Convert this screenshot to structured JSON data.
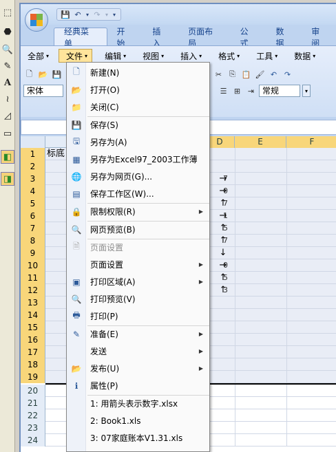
{
  "left_toolbar": {
    "tools": [
      "select-icon",
      "paint-icon",
      "zoom-icon",
      "pen-icon",
      "text-icon",
      "freehand-icon",
      "eraser-icon",
      "shape-icon",
      "green-3d-icon",
      "green-layers-icon"
    ]
  },
  "quick_access": {
    "save": "💾",
    "undo": "↶",
    "undo_dd": "▾",
    "redo": "↷",
    "redo_dd": "▾",
    "customize": "▾"
  },
  "ribbon_tabs": [
    "经典菜单",
    "开始",
    "插入",
    "页面布局",
    "公式",
    "数据",
    "审阅"
  ],
  "classic_menubar": [
    {
      "label": "全部",
      "open": false
    },
    {
      "label": "文件",
      "open": true
    },
    {
      "label": "编辑",
      "open": false
    },
    {
      "label": "视图",
      "open": false
    },
    {
      "label": "插入",
      "open": false
    },
    {
      "label": "格式",
      "open": false
    },
    {
      "label": "工具",
      "open": false
    },
    {
      "label": "数据",
      "open": false
    }
  ],
  "toolbar": {
    "font_name": "宋体",
    "number_format": "常规"
  },
  "columns": [
    "D",
    "E",
    "F"
  ],
  "rows": [
    {
      "n": "1",
      "a": "标底",
      "d": "",
      "arr": ""
    },
    {
      "n": "2",
      "a": "",
      "d": "",
      "arr": ""
    },
    {
      "n": "3",
      "a": "",
      "d": "7",
      "arr": "→"
    },
    {
      "n": "4",
      "a": "",
      "d": "0",
      "arr": "→"
    },
    {
      "n": "5",
      "a": "",
      "d": "7",
      "arr": "↑"
    },
    {
      "n": "6",
      "a": "",
      "d": "1",
      "arr": "→"
    },
    {
      "n": "7",
      "a": "",
      "d": "5",
      "arr": "↑"
    },
    {
      "n": "8",
      "a": "",
      "d": "7",
      "arr": "↑"
    },
    {
      "n": "9",
      "a": "",
      "d": "",
      "arr": "↓"
    },
    {
      "n": "10",
      "a": "",
      "d": "0",
      "arr": "→"
    },
    {
      "n": "11",
      "a": "",
      "d": "5",
      "arr": "↑"
    },
    {
      "n": "12",
      "a": "",
      "d": "3",
      "arr": "↑"
    },
    {
      "n": "13",
      "a": "",
      "d": "",
      "arr": ""
    },
    {
      "n": "14",
      "a": "",
      "d": "",
      "arr": ""
    },
    {
      "n": "15",
      "a": "",
      "d": "",
      "arr": ""
    },
    {
      "n": "16",
      "a": "",
      "d": "",
      "arr": ""
    },
    {
      "n": "17",
      "a": "",
      "d": "",
      "arr": ""
    },
    {
      "n": "18",
      "a": "",
      "d": "",
      "arr": ""
    },
    {
      "n": "19",
      "a": "",
      "d": "",
      "arr": ""
    },
    {
      "n": "20",
      "a": "",
      "d": "",
      "arr": ""
    },
    {
      "n": "21",
      "a": "",
      "d": "",
      "arr": ""
    },
    {
      "n": "22",
      "a": "",
      "d": "",
      "arr": ""
    },
    {
      "n": "23",
      "a": "",
      "d": "",
      "arr": ""
    },
    {
      "n": "24",
      "a": "",
      "d": "",
      "arr": ""
    }
  ],
  "file_menu": {
    "items": [
      {
        "label": "新建(N)",
        "icon": "new-doc-icon",
        "glyph": "🗋",
        "submenu": false,
        "disabled": false
      },
      {
        "label": "打开(O)",
        "icon": "open-folder-icon",
        "glyph": "📂",
        "submenu": false,
        "disabled": false
      },
      {
        "label": "关闭(C)",
        "icon": "close-folder-icon",
        "glyph": "📁",
        "submenu": false,
        "disabled": false
      },
      {
        "sep": true
      },
      {
        "label": "保存(S)",
        "icon": "save-icon",
        "glyph": "💾",
        "submenu": false,
        "disabled": false
      },
      {
        "label": "另存为(A)",
        "icon": "save-as-icon",
        "glyph": "🖫",
        "submenu": false,
        "disabled": false
      },
      {
        "label": "另存为Excel97_2003工作薄",
        "icon": "excel-icon",
        "glyph": "▦",
        "submenu": false,
        "disabled": false
      },
      {
        "label": "另存为网页(G)...",
        "icon": "webpage-icon",
        "glyph": "🌐",
        "submenu": false,
        "disabled": false
      },
      {
        "label": "保存工作区(W)...",
        "icon": "workspace-icon",
        "glyph": "▤",
        "submenu": false,
        "disabled": false
      },
      {
        "sep": true
      },
      {
        "label": "限制权限(R)",
        "icon": "permission-icon",
        "glyph": "🔒",
        "submenu": true,
        "disabled": false
      },
      {
        "sep": true
      },
      {
        "label": "网页预览(B)",
        "icon": "web-preview-icon",
        "glyph": "🔍",
        "submenu": false,
        "disabled": false
      },
      {
        "sep": true
      },
      {
        "label": "页面设置",
        "icon": "page-setup-dim-icon",
        "glyph": "🗎",
        "submenu": false,
        "disabled": true
      },
      {
        "label": "页面设置",
        "icon": "",
        "glyph": "",
        "submenu": true,
        "disabled": false
      },
      {
        "label": "打印区域(A)",
        "icon": "print-area-icon",
        "glyph": "▣",
        "submenu": true,
        "disabled": false
      },
      {
        "label": "打印预览(V)",
        "icon": "print-preview-icon",
        "glyph": "🔍",
        "submenu": false,
        "disabled": false
      },
      {
        "label": "打印(P)",
        "icon": "printer-icon",
        "glyph": "🖶",
        "submenu": false,
        "disabled": false
      },
      {
        "sep": true
      },
      {
        "label": "准备(E)",
        "icon": "prepare-icon",
        "glyph": "✎",
        "submenu": true,
        "disabled": false
      },
      {
        "label": "发送",
        "icon": "",
        "glyph": "",
        "submenu": true,
        "disabled": false
      },
      {
        "label": "发布(U)",
        "icon": "publish-icon",
        "glyph": "📂",
        "submenu": true,
        "disabled": false
      },
      {
        "label": "属性(P)",
        "icon": "properties-icon",
        "glyph": "ℹ",
        "submenu": false,
        "disabled": false
      },
      {
        "sep": true
      },
      {
        "label": "1: 用箭头表示数字.xlsx",
        "icon": "",
        "glyph": "",
        "submenu": false,
        "disabled": false
      },
      {
        "label": "2: Book1.xls",
        "icon": "",
        "glyph": "",
        "submenu": false,
        "disabled": false
      },
      {
        "label": "3: 07家庭账本V1.31.xls",
        "icon": "",
        "glyph": "",
        "submenu": false,
        "disabled": false
      }
    ]
  }
}
